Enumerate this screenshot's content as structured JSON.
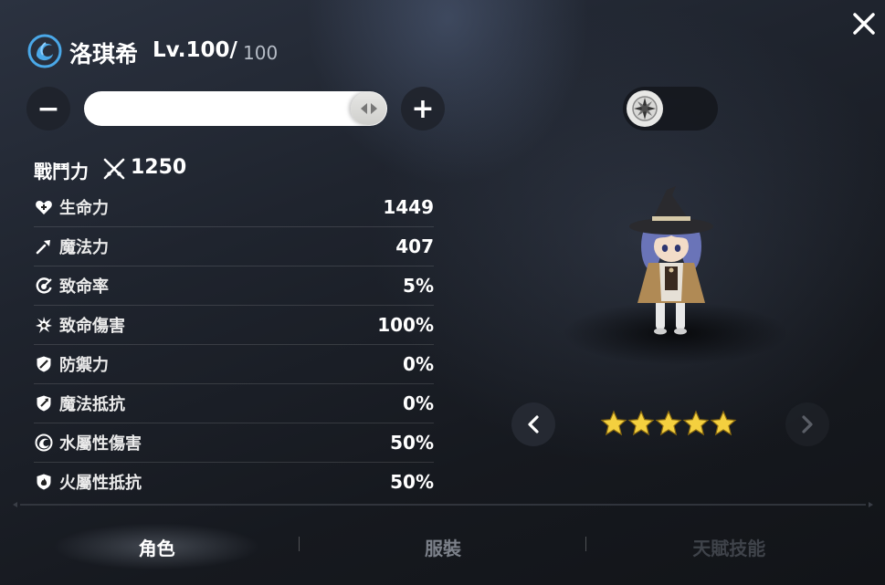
{
  "header": {
    "name": "洛琪希",
    "level": "Lv.100/",
    "level_max": "100",
    "element_icon": "water-element-icon",
    "close_icon": "close-icon"
  },
  "level_slider": {
    "minus_label": "−",
    "plus_label": "+",
    "level_fraction": 1.0
  },
  "power": {
    "label": "戰鬥力",
    "value": "1250",
    "icon": "crossed-swords-icon"
  },
  "stats": [
    {
      "label": "生命力",
      "value": "1449",
      "icon": "heart-plus-icon"
    },
    {
      "label": "魔法力",
      "value": "407",
      "icon": "staff-icon"
    },
    {
      "label": "致命率",
      "value": "5%",
      "icon": "critical-rate-icon"
    },
    {
      "label": "致命傷害",
      "value": "100%",
      "icon": "critical-damage-icon"
    },
    {
      "label": "防禦力",
      "value": "0%",
      "icon": "shield-icon"
    },
    {
      "label": "魔法抵抗",
      "value": "0%",
      "icon": "magic-shield-icon"
    },
    {
      "label": "水屬性傷害",
      "value": "50%",
      "icon": "water-damage-icon"
    },
    {
      "label": "火屬性抵抗",
      "value": "50%",
      "icon": "fire-resist-icon"
    }
  ],
  "rarity": {
    "stars": 5,
    "max_stars": 5
  },
  "tabs": [
    {
      "label": "角色",
      "state": "active"
    },
    {
      "label": "服裝",
      "state": "inactive"
    },
    {
      "label": "天賦技能",
      "state": "disabled"
    }
  ],
  "colors": {
    "star": "#f4d03f",
    "text": "#ffffff",
    "muted": "#7c818a"
  }
}
